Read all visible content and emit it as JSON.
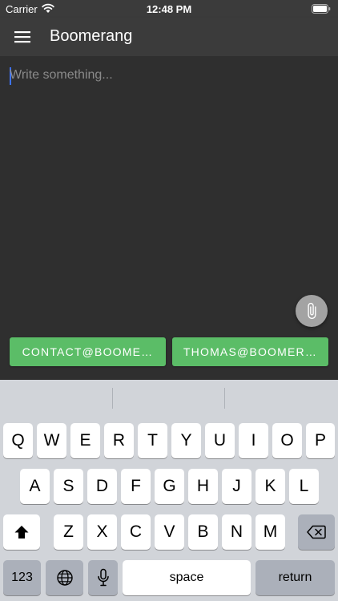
{
  "status_bar": {
    "carrier": "Carrier",
    "time": "12:48 PM",
    "icons": [
      "wifi-icon",
      "battery-icon"
    ]
  },
  "app_bar": {
    "title": "Boomerang",
    "menu_icon": "menu-icon"
  },
  "editor": {
    "placeholder": "Write something...",
    "value": "",
    "attach_icon": "paperclip-icon"
  },
  "recipients": [
    {
      "label": "CONTACT@BOOME…"
    },
    {
      "label": "THOMAS@BOOMER…"
    }
  ],
  "keyboard": {
    "row1": [
      "Q",
      "W",
      "E",
      "R",
      "T",
      "Y",
      "U",
      "I",
      "O",
      "P"
    ],
    "row2": [
      "A",
      "S",
      "D",
      "F",
      "G",
      "H",
      "J",
      "K",
      "L"
    ],
    "row3": [
      "Z",
      "X",
      "C",
      "V",
      "B",
      "N",
      "M"
    ],
    "numbers_label": "123",
    "space_label": "space",
    "return_label": "return",
    "icons": [
      "shift-icon",
      "backspace-icon",
      "globe-icon",
      "microphone-icon"
    ]
  },
  "colors": {
    "app_bar": "#3b3b3b",
    "background": "#2f2f2f",
    "chip": "#5bbd67",
    "attach_button": "#a3a3a3",
    "keyboard": "#d1d4d9"
  }
}
